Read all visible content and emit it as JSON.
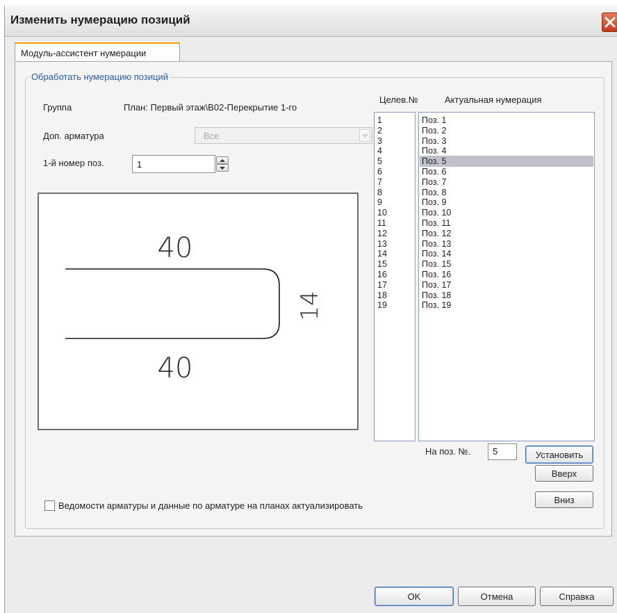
{
  "window": {
    "title": "Изменить нумерацию позиций"
  },
  "tabs": [
    {
      "label": "Модуль-ассистент нумерации"
    }
  ],
  "group": {
    "legend": "Обработать нумерацию позиций"
  },
  "fields": {
    "group_label": "Группа",
    "group_value": "План: Первый этаж\\B02-Перекрытие 1-го",
    "extra_rebar_label": "Доп. арматура",
    "extra_rebar_value": "Все",
    "first_pos_label": "1-й номер поз.",
    "first_pos_value": "1"
  },
  "preview": {
    "top_dimension": "40",
    "bottom_dimension": "40",
    "side_dimension": "14"
  },
  "lists": {
    "target_header": "Целев.№",
    "actual_header": "Актуальная нумерация",
    "target_numbers": [
      "1",
      "2",
      "3",
      "4",
      "5",
      "6",
      "7",
      "8",
      "9",
      "10",
      "11",
      "12",
      "13",
      "14",
      "15",
      "16",
      "17",
      "18",
      "19"
    ],
    "actual_positions": [
      "Поз. 1",
      "Поз. 2",
      "Поз. 3",
      "Поз. 4",
      "Поз. 5",
      "Поз. 6",
      "Поз. 7",
      "Поз. 8",
      "Поз. 9",
      "Поз. 10",
      "Поз. 11",
      "Поз. 12",
      "Поз. 13",
      "Поз. 14",
      "Поз. 15",
      "Поз. 16",
      "Поз. 17",
      "Поз. 18",
      "Поз. 19"
    ],
    "selected_actual": "Поз. 5"
  },
  "move": {
    "label": "На поз. №.",
    "value": "5",
    "set_label": "Установить",
    "up_label": "Вверх",
    "down_label": "Вниз"
  },
  "checkbox": {
    "label": "Ведомости арматуры и данные по арматуре на планах актуализировать",
    "checked": false
  },
  "footer": {
    "ok_label": "OK",
    "cancel_label": "Отмена",
    "help_label": "Справка"
  },
  "colors": {
    "accent_tab": "#f0a000",
    "legend_text": "#2a5ca8",
    "selection": "#c0c0cc",
    "close_button": "#c8391a"
  },
  "icons": [
    "close-icon",
    "chevron-down-icon",
    "spin-up-icon",
    "spin-down-icon"
  ]
}
